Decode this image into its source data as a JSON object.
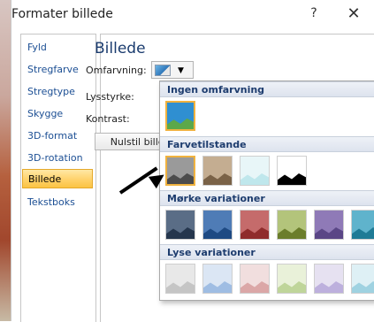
{
  "window": {
    "title": "Formater billede",
    "help_label": "?",
    "close_label": "✕"
  },
  "sidebar": {
    "items": [
      {
        "label": "Fyld"
      },
      {
        "label": "Stregfarve"
      },
      {
        "label": "Stregtype"
      },
      {
        "label": "Skygge"
      },
      {
        "label": "3D-format"
      },
      {
        "label": "3D-rotation"
      },
      {
        "label": "Billede",
        "active": true
      },
      {
        "label": "Tekstboks"
      }
    ]
  },
  "main": {
    "section_title": "Billede",
    "recolor_label": "Omfarvning:",
    "brightness_label": "Lysstyrke:",
    "contrast_label": "Kontrast:",
    "reset_label": "Nulstil billede"
  },
  "dropdown": {
    "sections": [
      {
        "title": "Ingen omfarvning"
      },
      {
        "title": "Farvetilstande"
      },
      {
        "title": "Mørke variationer"
      },
      {
        "title": "Lyse variationer"
      }
    ],
    "no_recolor_swatch": {
      "sky": "#2f8fd1",
      "ground": "#5ca84a"
    },
    "color_modes": [
      {
        "name": "Gråtone",
        "sky": "#9a9a9a",
        "ground": "#4c4c4c"
      },
      {
        "name": "Sepia",
        "sky": "#c4ad91",
        "ground": "#7a6247"
      },
      {
        "name": "Udvasket",
        "sky": "#e8f6f8",
        "ground": "#bfe7ec"
      },
      {
        "name": "Sort og hvid",
        "sky": "#ffffff",
        "ground": "#000000"
      }
    ],
    "dark_variations": [
      {
        "sky": "#5a6d86",
        "ground": "#25364d"
      },
      {
        "sky": "#4f7cb6",
        "ground": "#1e4a83"
      },
      {
        "sky": "#c56b6b",
        "ground": "#8f2c2c"
      },
      {
        "sky": "#b3c47b",
        "ground": "#6b7d2b"
      },
      {
        "sky": "#8f7ab7",
        "ground": "#5a4686"
      },
      {
        "sky": "#5fb3cc",
        "ground": "#1f7b96"
      }
    ],
    "light_variations": [
      {
        "sky": "#e8e8e8",
        "ground": "#c5c5c5"
      },
      {
        "sky": "#dbe6f4",
        "ground": "#9fbde3"
      },
      {
        "sky": "#f1dede",
        "ground": "#dba7a7"
      },
      {
        "sky": "#e9f1d9",
        "ground": "#bfd59a"
      },
      {
        "sky": "#e6e1f1",
        "ground": "#bdb0dd"
      },
      {
        "sky": "#def0f5",
        "ground": "#9fd2e1"
      }
    ]
  }
}
